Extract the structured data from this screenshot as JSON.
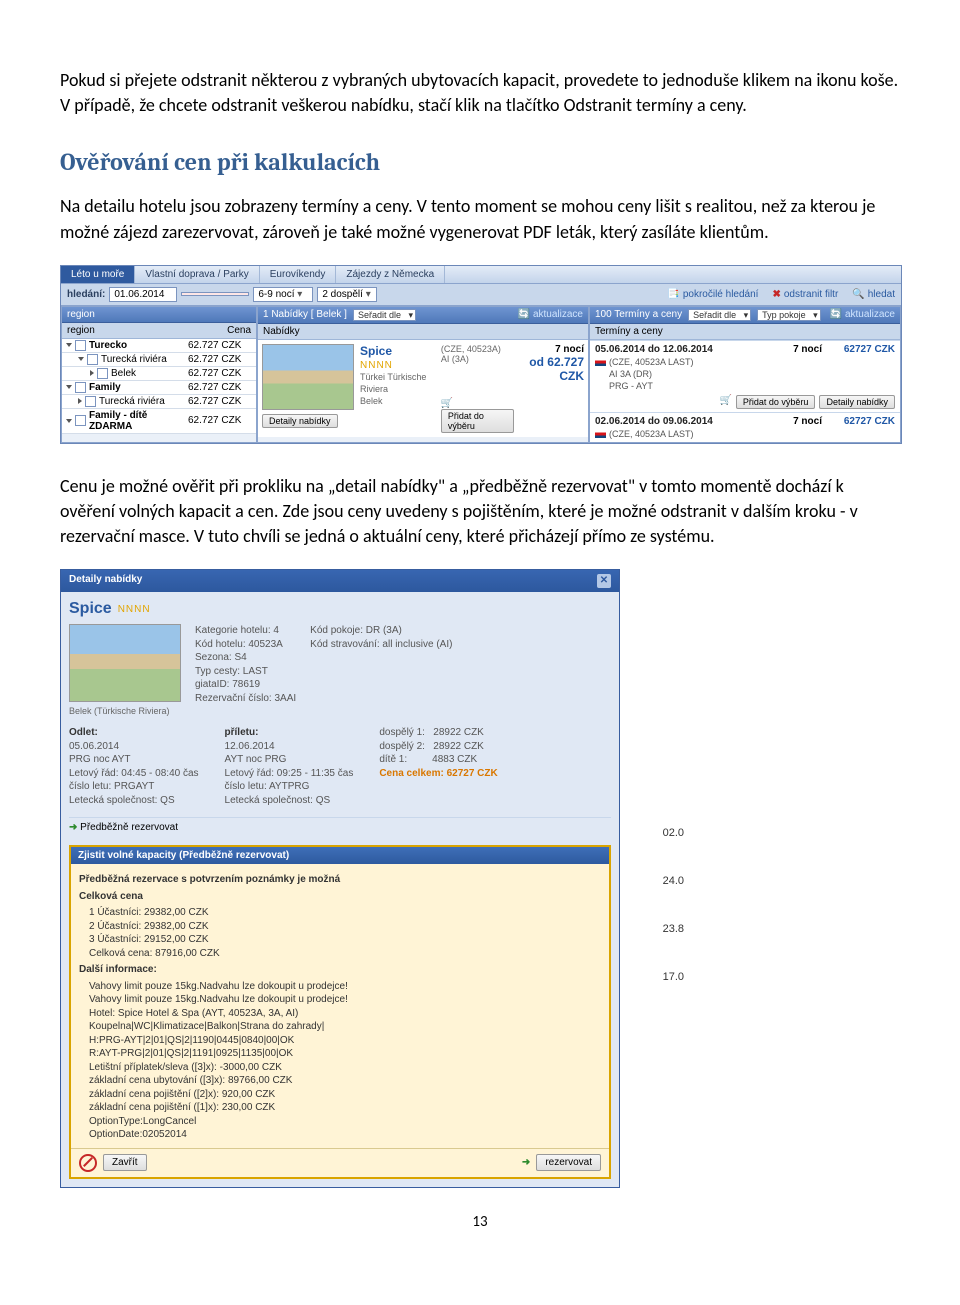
{
  "doc": {
    "para1": "Pokud si přejete odstranit některou z vybraných ubytovacích kapacit, provedete to jednoduše klikem na ikonu koše. V případě, že chcete odstranit veškerou nabídku, stačí klik na tlačítko Odstranit termíny a ceny.",
    "heading": "Ověřování cen při kalkulacích",
    "para2": "Na detailu hotelu jsou zobrazeny termíny a ceny. V tento moment se mohou ceny lišit s realitou, než za kterou je možné zájezd zarezervovat, zároveň je také možné vygenerovat PDF leták, který zasíláte klientům.",
    "para3": "Cenu je možné ověřit  při prokliku na „detail nabídky\" a „předběžně rezervovat\" v tomto momentě dochází k ověření volných kapacit a cen. Zde jsou ceny uvedeny s pojištěním, které je možné odstranit v dalším kroku - v rezervační masce. V tuto chvíli se jedná o aktuální ceny, které přicházejí přímo ze systému.",
    "page": "13"
  },
  "app1": {
    "tabs": [
      "Léto u moře",
      "Vlastní doprava / Parky",
      "Eurovíkendy",
      "Zájezdy z Německa"
    ],
    "search_label": "hledání:",
    "search": {
      "date1": "01.06.2014",
      "date2": "",
      "nights": "6-9 nocí",
      "pax": "2 dospělí"
    },
    "links": {
      "adv": "pokročilé hledání",
      "remove": "odstranit filtr",
      "search_btn": "hledat"
    },
    "left": {
      "title": "region",
      "region_hdr": "region",
      "price_hdr": "Cena",
      "rows": [
        {
          "name": "Turecko",
          "price": "62.727 CZK",
          "lvl": 0,
          "bold": true
        },
        {
          "name": "Turecká riviéra",
          "price": "62.727 CZK",
          "lvl": 1
        },
        {
          "name": "Belek",
          "price": "62.727 CZK",
          "lvl": 2
        },
        {
          "name": "Family",
          "price": "62.727 CZK",
          "lvl": 0,
          "bold": true
        },
        {
          "name": "Turecká riviéra",
          "price": "62.727 CZK",
          "lvl": 1
        },
        {
          "name": "Family - dítě ZDARMA",
          "price": "62.727 CZK",
          "lvl": 0,
          "bold": true
        }
      ]
    },
    "mid": {
      "title": "1 Nabídky [ Belek ]",
      "sort": "Seřadit dle",
      "refresh": "aktualizace",
      "sub": "Nabídky",
      "hotel": "Spice",
      "stars": "NNNN",
      "desc1": "Türkei Türkische Riviera",
      "desc2": "Belek",
      "btn_detail": "Detaily nabídky",
      "code": "(CZE, 40523A)",
      "meal": "AI (3A)",
      "nights": "7 nocí",
      "price": "od 62.727 CZK",
      "btn_add": "Přidat do výběru"
    },
    "right": {
      "title": "100 Termíny a ceny",
      "sort": "Seřadit dle",
      "room": "Typ pokoje",
      "refresh": "aktualizace",
      "sub": "Termíny a ceny",
      "terms": [
        {
          "date": "05.06.2014 do 12.06.2014",
          "noci": "7 nocí",
          "price": "62727 CZK",
          "code": "(CZE, 40523A LAST)",
          "meal": "AI 3A (DR)",
          "route": "PRG - AYT",
          "btn1": "Přidat do výběru",
          "btn2": "Detaily nabídky"
        },
        {
          "date": "02.06.2014 do 09.06.2014",
          "noci": "7 nocí",
          "price": "62727 CZK",
          "code": "(CZE, 40523A LAST)"
        }
      ]
    }
  },
  "app2": {
    "title": "Detaily nabídky",
    "hotel": "Spice",
    "stars": "NNNN",
    "loc": "Belek (Türkische Riviera)",
    "left_kv": [
      "Kategorie hotelu: 4",
      "Kód hotelu: 40523A",
      "Sezona: S4",
      "Typ cesty: LAST",
      "giataID: 78619",
      "Rezervační číslo: 3AAI"
    ],
    "right_kv": [
      "Kód pokoje: DR (3A)",
      "Kód stravování: all inclusive (AI)"
    ],
    "col1_title": "Odlet:",
    "col1": [
      "05.06.2014",
      "PRG noc AYT",
      "Letový řád: 04:45 - 08:40 čas",
      "číslo letu: PRGAYT",
      "Letecká společnost: QS"
    ],
    "col2_title": "příletu:",
    "col2": [
      "12.06.2014",
      "AYT noc PRG",
      "Letový řád: 09:25 - 11:35 čas",
      "číslo letu: AYTPRG",
      "Letecká společnost: QS"
    ],
    "col3": [
      {
        "l": "dospělý 1:",
        "v": "28922 CZK"
      },
      {
        "l": "dospělý 2:",
        "v": "28922 CZK"
      },
      {
        "l": "dítě 1:",
        "v": "4883 CZK"
      }
    ],
    "total_label": "Cena celkem:",
    "total": "62727 CZK",
    "pre_reserve": "Předběžně rezervovat",
    "hl_title": "Zjistit volné kapacity (Předběžně rezervovat)",
    "hl_sub": "Předběžná rezervace s potvrzením poznámky je možná",
    "hl_price_hdr": "Celková cena",
    "hl_prices": [
      "1 Účastníci: 29382,00 CZK",
      "2 Účastníci: 29382,00 CZK",
      "3 Účastníci: 29152,00 CZK",
      "Celková cena: 87916,00 CZK"
    ],
    "hl_info_hdr": "Další informace:",
    "hl_info": [
      "Vahovy limit pouze 15kg.Nadvahu lze dokoupit u prodejce!",
      "Vahovy limit pouze 15kg.Nadvahu lze dokoupit u prodejce!",
      "Hotel: Spice Hotel & Spa (AYT, 40523A, 3A, AI)",
      "Koupelna|WC|Klimatizace|Balkon|Strana do zahrady|",
      "H:PRG-AYT|2|01|QS|2|1190|0445|0840|00|OK",
      "R:AYT-PRG|2|01|QS|2|1191|0925|1135|00|OK",
      "Letištní příplatek/sleva ([3]x): -3000,00 CZK",
      "základní cena ubytování ([3]x): 89766,00 CZK",
      "základní cena pojištění ([2]x): 920,00 CZK",
      "základní cena pojištění ([1]x): 230,00 CZK",
      "OptionType:LongCancel",
      "OptionDate:02052014"
    ],
    "btn_close": "Zavřít",
    "btn_reserve": "rezervovat",
    "side_dates": [
      "02.0",
      "24.0",
      "23.8",
      "17.0"
    ]
  }
}
